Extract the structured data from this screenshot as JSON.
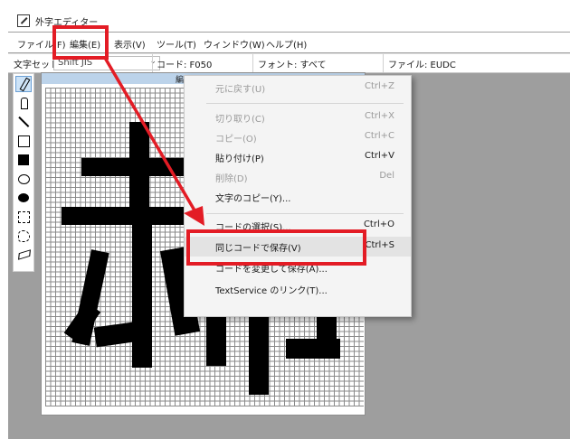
{
  "window": {
    "title": "外字エディター"
  },
  "menubar": {
    "items": [
      {
        "label": "ファイル(F)"
      },
      {
        "label": "編集(E)"
      },
      {
        "label": "表示(V)"
      },
      {
        "label": "ツール(T)"
      },
      {
        "label": "ウィンドウ(W)"
      },
      {
        "label": "ヘルプ(H)"
      }
    ]
  },
  "infobar": {
    "charset_label": "文字セット:",
    "charset_value": "Shift JIS",
    "code": "コード: F050",
    "font": "フォント: すべて",
    "file": "ファイル: EUDC"
  },
  "tools": [
    {
      "icon": "pencil-icon"
    },
    {
      "icon": "brush-icon"
    },
    {
      "icon": "line-icon"
    },
    {
      "icon": "rectangle-outline-icon"
    },
    {
      "icon": "rectangle-filled-icon"
    },
    {
      "icon": "ellipse-outline-icon"
    },
    {
      "icon": "ellipse-filled-icon"
    },
    {
      "icon": "rect-select-icon"
    },
    {
      "icon": "freeform-select-icon"
    },
    {
      "icon": "eraser-icon"
    }
  ],
  "edit_window": {
    "title": "編"
  },
  "edit_menu": {
    "items": [
      {
        "label": "元に戻す(U)",
        "shortcut": "Ctrl+Z",
        "enabled": false
      },
      {
        "label": "切り取り(C)",
        "shortcut": "Ctrl+X",
        "enabled": false
      },
      {
        "label": "コピー(O)",
        "shortcut": "Ctrl+C",
        "enabled": false
      },
      {
        "label": "貼り付け(P)",
        "shortcut": "Ctrl+V",
        "enabled": true
      },
      {
        "label": "削除(D)",
        "shortcut": "Del",
        "enabled": false
      },
      {
        "label": "文字のコピー(Y)...",
        "shortcut": "",
        "enabled": true
      },
      {
        "label": "コードの選択(S)...",
        "shortcut": "Ctrl+O",
        "enabled": true
      },
      {
        "label": "同じコードで保存(V)",
        "shortcut": "Ctrl+S",
        "enabled": true
      },
      {
        "label": "コードを変更して保存(A)...",
        "shortcut": "",
        "enabled": true
      },
      {
        "label": "TextService のリンク(T)...",
        "shortcut": "",
        "enabled": true
      }
    ]
  },
  "colors": {
    "annotation": "#e31c25",
    "highlight_hover": "#e3e3e3",
    "edit_header": "#bcd3ea"
  }
}
